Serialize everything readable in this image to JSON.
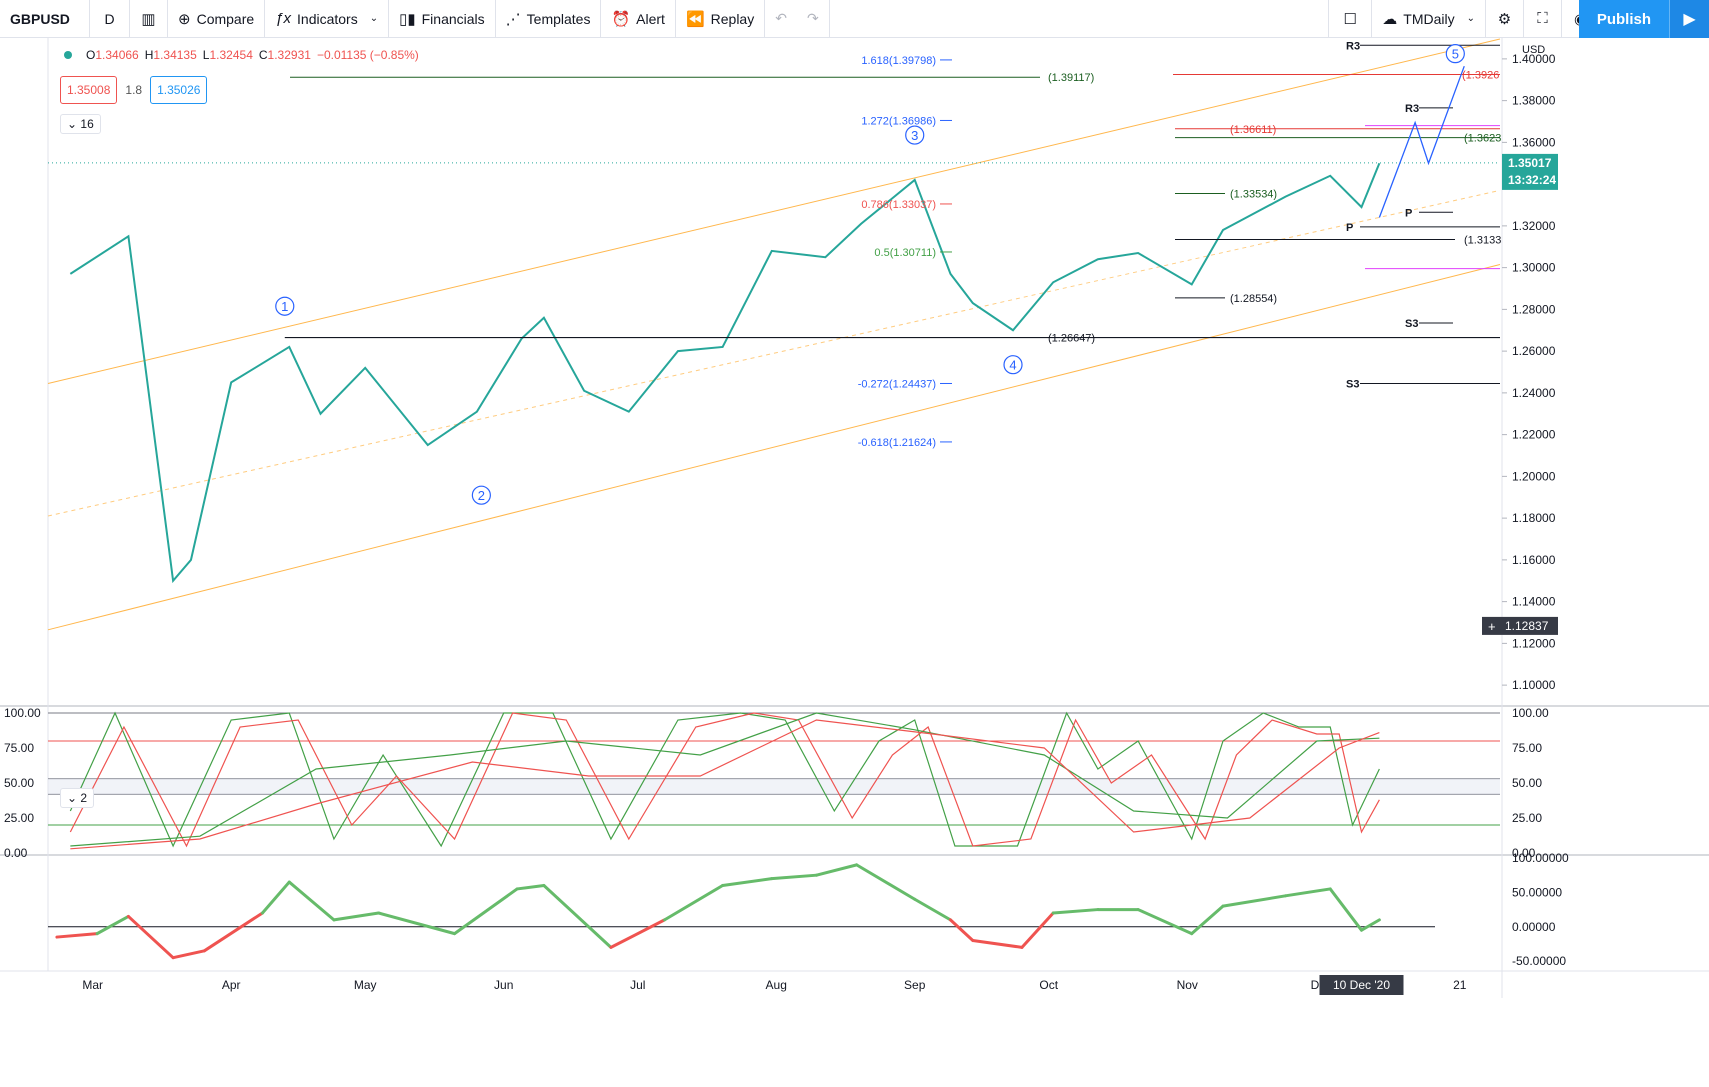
{
  "toolbar": {
    "symbol": "GBPUSD",
    "interval": "D",
    "compare": "Compare",
    "indicators": "Indicators",
    "financials": "Financials",
    "templates": "Templates",
    "alert": "Alert",
    "replay": "Replay",
    "layout_name": "TMDaily",
    "publish": "Publish"
  },
  "legend": {
    "open_label": "O",
    "open": "1.34066",
    "high_label": "H",
    "high": "1.34135",
    "low_label": "L",
    "low": "1.32454",
    "close_label": "C",
    "close": "1.32931",
    "change": "−0.01135 (−0.85%)",
    "bid": "1.35008",
    "spread": "1.8",
    "ask": "1.35026",
    "indicators_count": "16",
    "osc_count": "2"
  },
  "price_scale": {
    "currency": "USD",
    "ticks": [
      "1.40000",
      "1.38000",
      "1.36000",
      "1.34000",
      "1.32000",
      "1.30000",
      "1.28000",
      "1.26000",
      "1.24000",
      "1.22000",
      "1.20000",
      "1.18000",
      "1.16000",
      "1.14000",
      "1.12000",
      "1.10000"
    ],
    "last_price": "1.35017",
    "countdown": "13:32:24",
    "crosshair_price": "1.12837",
    "r3_fib_label": "(1.3926"
  },
  "time_axis": {
    "labels": [
      "Mar",
      "Apr",
      "May",
      "Jun",
      "Jul",
      "Aug",
      "Sep",
      "Oct",
      "Nov",
      "Dec",
      "21"
    ],
    "current": "10 Dec '20"
  },
  "osc1_scale": [
    "100.00",
    "75.00",
    "50.00",
    "25.00",
    "0.00"
  ],
  "osc2_scale": [
    "100.00000",
    "50.00000",
    "0.00000",
    "-50.00000"
  ],
  "annotations": {
    "fib": [
      {
        "text": "1.618(1.39798)",
        "price": 1.3995,
        "color": "#2962ff"
      },
      {
        "text": "1.272(1.36986)",
        "price": 1.3705,
        "color": "#2962ff"
      },
      {
        "text": "0.786(1.33037)",
        "price": 1.3305,
        "color": "#ef5350"
      },
      {
        "text": "0.5(1.30711)",
        "price": 1.3075,
        "color": "#43a047"
      },
      {
        "text": "-0.272(1.24437)",
        "price": 1.2445,
        "color": "#2962ff"
      },
      {
        "text": "-0.618(1.21624)",
        "price": 1.2165,
        "color": "#2962ff"
      }
    ],
    "levels": [
      {
        "text": "(1.39117)",
        "price": 1.3912,
        "color": "#1b5e20"
      },
      {
        "text": "(1.36611)",
        "price": 1.3665,
        "color": "#e53935"
      },
      {
        "text": "(1.3623",
        "price": 1.3623,
        "color": "#1b5e20"
      },
      {
        "text": "(1.33534)",
        "price": 1.3355,
        "color": "#1b5e20"
      },
      {
        "text": "(1.3133",
        "price": 1.3135,
        "color": "#131722"
      },
      {
        "text": "(1.28554)",
        "price": 1.2855,
        "color": "#131722"
      },
      {
        "text": "(1.26647)",
        "price": 1.2665,
        "color": "#131722"
      }
    ],
    "pivots": [
      {
        "text": "R3",
        "price": 1.4065
      },
      {
        "text": "R3",
        "price": 1.3765
      },
      {
        "text": "P",
        "price": 1.3265
      },
      {
        "text": "P",
        "price": 1.3195
      },
      {
        "text": "S3",
        "price": 1.2735
      },
      {
        "text": "S3",
        "price": 1.2445
      }
    ],
    "waves": [
      {
        "text": "1",
        "date": "2020-04-13",
        "price": 1.2815
      },
      {
        "text": "2",
        "date": "2020-05-27",
        "price": 1.191
      },
      {
        "text": "3",
        "date": "2020-09-01",
        "price": 1.3635
      },
      {
        "text": "4",
        "date": "2020-09-23",
        "price": 1.2535
      },
      {
        "text": "5",
        "date": "2020-12-31",
        "price": 1.4025
      }
    ]
  },
  "chart_data": [
    {
      "type": "line",
      "title": "GBPUSD",
      "subtitle": "D",
      "series": [
        {
          "values": [
            [
              "2020-02-25",
              1.297
            ],
            [
              "2020-03-09",
              1.315
            ],
            [
              "2020-03-19",
              1.15
            ],
            [
              "2020-03-23",
              1.16
            ],
            [
              "2020-04-01",
              1.245
            ],
            [
              "2020-04-14",
              1.262
            ],
            [
              "2020-04-21",
              1.23
            ],
            [
              "2020-05-01",
              1.252
            ],
            [
              "2020-05-15",
              1.215
            ],
            [
              "2020-05-26",
              1.231
            ],
            [
              "2020-06-05",
              1.266
            ],
            [
              "2020-06-10",
              1.276
            ],
            [
              "2020-06-19",
              1.241
            ],
            [
              "2020-06-29",
              1.231
            ],
            [
              "2020-07-10",
              1.26
            ],
            [
              "2020-07-20",
              1.262
            ],
            [
              "2020-07-31",
              1.308
            ],
            [
              "2020-08-12",
              1.305
            ],
            [
              "2020-08-20",
              1.321
            ],
            [
              "2020-09-01",
              1.342
            ],
            [
              "2020-09-09",
              1.297
            ],
            [
              "2020-09-14",
              1.283
            ],
            [
              "2020-09-23",
              1.27
            ],
            [
              "2020-10-02",
              1.293
            ],
            [
              "2020-10-12",
              1.304
            ],
            [
              "2020-10-21",
              1.307
            ],
            [
              "2020-11-02",
              1.292
            ],
            [
              "2020-11-09",
              1.318
            ],
            [
              "2020-11-23",
              1.334
            ],
            [
              "2020-12-03",
              1.344
            ],
            [
              "2020-12-10",
              1.329
            ],
            [
              "2020-12-14",
              1.35
            ]
          ]
        }
      ],
      "x_range": [
        "2020-02-20",
        "2021-01-10"
      ],
      "ylim": [
        1.09,
        1.41
      ],
      "grid": false
    },
    {
      "type": "line",
      "title": "",
      "series": [
        {
          "color": "#43a047",
          "values": [
            [
              "2020-02-25",
              30
            ],
            [
              "2020-03-06",
              100
            ],
            [
              "2020-03-19",
              5
            ],
            [
              "2020-04-01",
              95
            ],
            [
              "2020-04-14",
              100
            ],
            [
              "2020-04-24",
              10
            ],
            [
              "2020-05-05",
              70
            ],
            [
              "2020-05-18",
              5
            ],
            [
              "2020-06-01",
              100
            ],
            [
              "2020-06-12",
              100
            ],
            [
              "2020-06-25",
              10
            ],
            [
              "2020-07-10",
              95
            ],
            [
              "2020-07-24",
              100
            ],
            [
              "2020-08-03",
              95
            ],
            [
              "2020-08-14",
              30
            ],
            [
              "2020-08-24",
              80
            ],
            [
              "2020-09-01",
              95
            ],
            [
              "2020-09-10",
              5
            ],
            [
              "2020-09-24",
              5
            ],
            [
              "2020-10-05",
              100
            ],
            [
              "2020-10-12",
              60
            ],
            [
              "2020-10-21",
              80
            ],
            [
              "2020-11-02",
              10
            ],
            [
              "2020-11-09",
              80
            ],
            [
              "2020-11-18",
              100
            ],
            [
              "2020-11-26",
              90
            ],
            [
              "2020-12-03",
              90
            ],
            [
              "2020-12-08",
              20
            ],
            [
              "2020-12-14",
              60
            ]
          ]
        },
        {
          "color": "#ef5350",
          "values": [
            [
              "2020-02-25",
              15
            ],
            [
              "2020-03-08",
              90
            ],
            [
              "2020-03-22",
              5
            ],
            [
              "2020-04-03",
              90
            ],
            [
              "2020-04-16",
              95
            ],
            [
              "2020-04-28",
              20
            ],
            [
              "2020-05-08",
              55
            ],
            [
              "2020-05-21",
              10
            ],
            [
              "2020-06-03",
              100
            ],
            [
              "2020-06-15",
              95
            ],
            [
              "2020-06-29",
              10
            ],
            [
              "2020-07-14",
              90
            ],
            [
              "2020-07-27",
              100
            ],
            [
              "2020-08-06",
              95
            ],
            [
              "2020-08-18",
              25
            ],
            [
              "2020-08-27",
              70
            ],
            [
              "2020-09-04",
              90
            ],
            [
              "2020-09-14",
              5
            ],
            [
              "2020-09-27",
              10
            ],
            [
              "2020-10-07",
              95
            ],
            [
              "2020-10-15",
              50
            ],
            [
              "2020-10-24",
              70
            ],
            [
              "2020-11-05",
              10
            ],
            [
              "2020-11-12",
              70
            ],
            [
              "2020-11-20",
              95
            ],
            [
              "2020-11-30",
              85
            ],
            [
              "2020-12-05",
              85
            ],
            [
              "2020-12-10",
              15
            ],
            [
              "2020-12-14",
              38
            ]
          ]
        },
        {
          "color": "#43a047",
          "values": [
            [
              "2020-02-25",
              5
            ],
            [
              "2020-03-25",
              12
            ],
            [
              "2020-04-20",
              60
            ],
            [
              "2020-05-20",
              70
            ],
            [
              "2020-06-15",
              80
            ],
            [
              "2020-07-15",
              70
            ],
            [
              "2020-08-10",
              100
            ],
            [
              "2020-09-01",
              88
            ],
            [
              "2020-09-30",
              70
            ],
            [
              "2020-10-20",
              30
            ],
            [
              "2020-11-10",
              25
            ],
            [
              "2020-11-30",
              80
            ],
            [
              "2020-12-14",
              82
            ]
          ]
        },
        {
          "color": "#ef5350",
          "values": [
            [
              "2020-02-25",
              3
            ],
            [
              "2020-03-25",
              10
            ],
            [
              "2020-04-20",
              35
            ],
            [
              "2020-05-25",
              65
            ],
            [
              "2020-06-20",
              55
            ],
            [
              "2020-07-15",
              55
            ],
            [
              "2020-08-10",
              95
            ],
            [
              "2020-09-05",
              85
            ],
            [
              "2020-09-30",
              75
            ],
            [
              "2020-10-20",
              15
            ],
            [
              "2020-11-15",
              25
            ],
            [
              "2020-12-05",
              75
            ],
            [
              "2020-12-14",
              86
            ]
          ]
        }
      ],
      "levels": [
        100,
        80,
        53,
        42,
        20
      ],
      "ylim": [
        0,
        100
      ]
    },
    {
      "type": "line",
      "title": "",
      "series": [
        {
          "values": [
            [
              "2020-02-22",
              -15
            ],
            [
              "2020-03-02",
              -10
            ],
            [
              "2020-03-09",
              15
            ],
            [
              "2020-03-19",
              -45
            ],
            [
              "2020-03-26",
              -35
            ],
            [
              "2020-04-08",
              20
            ],
            [
              "2020-04-14",
              65
            ],
            [
              "2020-04-24",
              10
            ],
            [
              "2020-05-04",
              20
            ],
            [
              "2020-05-21",
              -10
            ],
            [
              "2020-06-04",
              55
            ],
            [
              "2020-06-10",
              60
            ],
            [
              "2020-06-25",
              -30
            ],
            [
              "2020-07-07",
              10
            ],
            [
              "2020-07-20",
              60
            ],
            [
              "2020-07-31",
              70
            ],
            [
              "2020-08-10",
              75
            ],
            [
              "2020-08-19",
              90
            ],
            [
              "2020-09-01",
              40
            ],
            [
              "2020-09-09",
              10
            ],
            [
              "2020-09-14",
              -20
            ],
            [
              "2020-09-25",
              -30
            ],
            [
              "2020-10-02",
              20
            ],
            [
              "2020-10-12",
              25
            ],
            [
              "2020-10-21",
              25
            ],
            [
              "2020-11-02",
              -10
            ],
            [
              "2020-11-09",
              30
            ],
            [
              "2020-11-23",
              45
            ],
            [
              "2020-12-03",
              55
            ],
            [
              "2020-12-10",
              -5
            ],
            [
              "2020-12-14",
              10
            ]
          ]
        }
      ],
      "levels": [
        0
      ],
      "ylim": [
        -60,
        100
      ]
    }
  ],
  "colors": {
    "up": "#26a69a",
    "down": "#ef5350",
    "accent": "#2196f3"
  }
}
